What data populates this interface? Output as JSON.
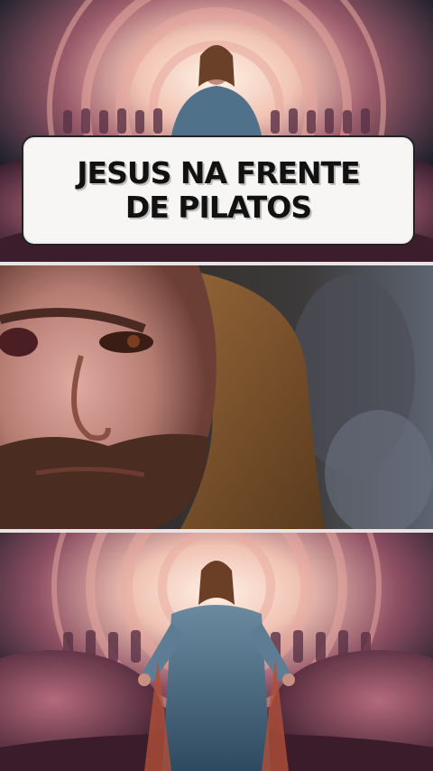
{
  "title": {
    "line1": "JESUS NA FRENTE",
    "line2": "DE PILATOS"
  },
  "colors": {
    "sky_glow": "#f3c9b8",
    "cloud": "#6e3448",
    "robe": "#3c5f78",
    "skin": "#c98f86",
    "hair": "#8a5a2c",
    "background_dark": "#141923"
  }
}
